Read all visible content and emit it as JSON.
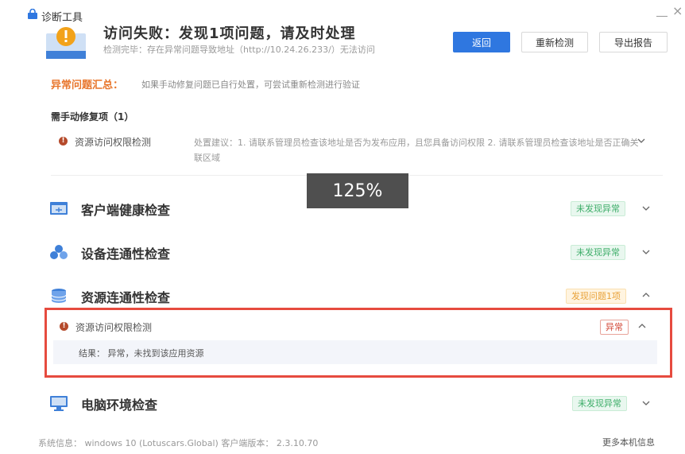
{
  "window": {
    "title": "诊断工具"
  },
  "header": {
    "headline": "访问失败：发现1项问题，请及时处理",
    "sub_label": "检测完毕：",
    "sub_text": "存在异常问题导致地址（http://10.24.26.233/）无法访问",
    "buttons": {
      "back": "返回",
      "recheck": "重新检测",
      "export": "导出报告"
    }
  },
  "summary": {
    "title": "异常问题汇总：",
    "hint": "如果手动修复问题已自行处置，可尝试重新检测进行验证"
  },
  "manual_repair": {
    "title": "需手动修复项（1）",
    "item": {
      "name": "资源访问权限检测",
      "advice": "处置建议：1. 请联系管理员检查该地址是否为发布应用，且您具备访问权限 2. 请联系管理员检查该地址是否正确关联区域"
    }
  },
  "overlay": {
    "zoom": "125%"
  },
  "sections": [
    {
      "label": "客户端健康检查",
      "status": "未发现异常",
      "status_type": "ok",
      "icon": "window-icon"
    },
    {
      "label": "设备连通性检查",
      "status": "未发现异常",
      "status_type": "ok",
      "icon": "network-nodes-icon"
    },
    {
      "label": "资源连通性检查",
      "status": "发现问题1项",
      "status_type": "warn",
      "icon": "database-icon"
    },
    {
      "label": "电脑环境检查",
      "status": "未发现异常",
      "status_type": "ok",
      "icon": "monitor-icon"
    }
  ],
  "resource_detail": {
    "name": "资源访问权限检测",
    "status": "异常",
    "result": "结果：  异常，未找到该应用资源"
  },
  "footer": {
    "system_info": "系统信息：  windows 10 (Lotuscars.Global)   客户端版本：  2.3.10.70",
    "more": "更多本机信息"
  },
  "colors": {
    "primary": "#2f77e0",
    "summary_orange": "#e8762c",
    "ok_green": "#3fae6a",
    "warn_orange": "#e8a23a",
    "error_red": "#d34a3a",
    "highlight_border": "#e64b3f"
  }
}
